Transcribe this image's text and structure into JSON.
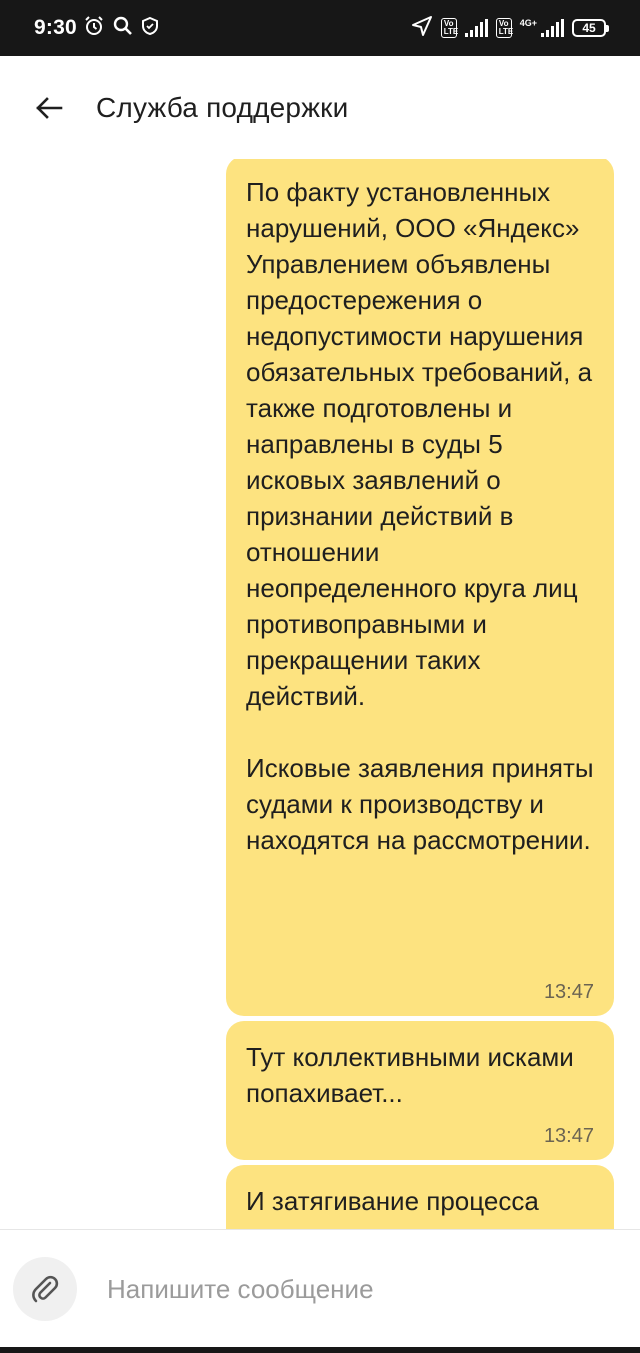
{
  "status_bar": {
    "time": "9:30",
    "battery": "45",
    "lte1": "Vo LTE",
    "lte2": "Vo LTE",
    "network": "4G+"
  },
  "header": {
    "title": "Служба поддержки"
  },
  "messages": [
    {
      "text": "По факту установленных нарушений, ООО «Яндекс» Управлением объявлены предостережения о недопустимости нарушения обязательных требований, а также подготовлены и направлены в суды 5 исковых заявлений о признании действий в отношении неопределенного круга лиц противоправными и прекращении таких действий.\n\nИсковые заявления приняты судами к производству и находятся на рассмотрении.",
      "time": "13:47"
    },
    {
      "text": "Тут коллективными исками попахивает...",
      "time": "13:47"
    },
    {
      "text": "И затягивание процесса",
      "time": ""
    }
  ],
  "composer": {
    "placeholder": "Напишите сообщение"
  },
  "colors": {
    "bubble": "#fde380",
    "status_bar": "#171717"
  }
}
